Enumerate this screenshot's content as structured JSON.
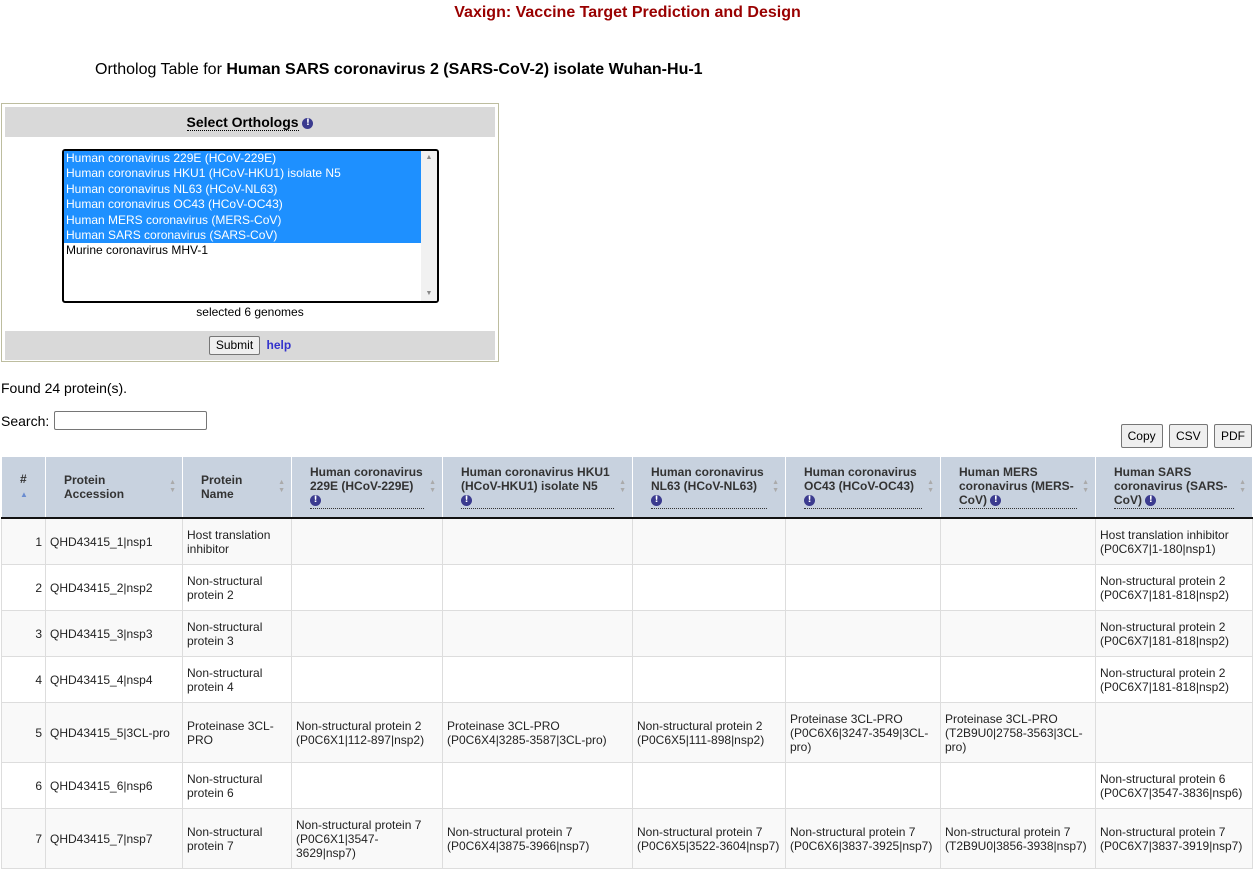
{
  "page": {
    "title": "Vaxign: Vaccine Target Prediction and Design",
    "subtitle_prefix": "Ortholog Table for",
    "subtitle_genome": "Human SARS coronavirus 2 (SARS-CoV-2) isolate Wuhan-Hu-1"
  },
  "selector": {
    "header": "Select Orthologs",
    "options": [
      {
        "label": "Human coronavirus 229E (HCoV-229E)",
        "selected": true
      },
      {
        "label": "Human coronavirus HKU1 (HCoV-HKU1) isolate N5",
        "selected": true
      },
      {
        "label": "Human coronavirus NL63 (HCoV-NL63)",
        "selected": true
      },
      {
        "label": "Human coronavirus OC43 (HCoV-OC43)",
        "selected": true
      },
      {
        "label": "Human MERS coronavirus (MERS-CoV)",
        "selected": true
      },
      {
        "label": "Human SARS coronavirus (SARS-CoV)",
        "selected": true
      },
      {
        "label": "Murine coronavirus MHV-1",
        "selected": false
      }
    ],
    "selected_text": "selected 6 genomes",
    "submit_label": "Submit",
    "help_label": "help"
  },
  "results": {
    "found_text": "Found 24 protein(s).",
    "search_label": "Search:",
    "search_value": ""
  },
  "toolbar": {
    "copy": "Copy",
    "csv": "CSV",
    "pdf": "PDF"
  },
  "table": {
    "headers": [
      "#",
      "Protein Accession",
      "Protein Name",
      "Human coronavirus 229E (HCoV-229E)",
      "Human coronavirus HKU1 (HCoV-HKU1) isolate N5",
      "Human coronavirus NL63 (HCoV-NL63)",
      "Human coronavirus OC43 (HCoV-OC43)",
      "Human MERS coronavirus (MERS-CoV)",
      "Human SARS coronavirus (SARS-CoV)"
    ],
    "rows": [
      {
        "n": "1",
        "acc": "QHD43415_1|nsp1",
        "name": "Host translation inhibitor",
        "c229e": "",
        "hku1": "",
        "nl63": "",
        "oc43": "",
        "mers": "",
        "sars": "Host translation inhibitor (P0C6X7|1-180|nsp1)"
      },
      {
        "n": "2",
        "acc": "QHD43415_2|nsp2",
        "name": "Non-structural protein 2",
        "c229e": "",
        "hku1": "",
        "nl63": "",
        "oc43": "",
        "mers": "",
        "sars": "Non-structural protein 2 (P0C6X7|181-818|nsp2)"
      },
      {
        "n": "3",
        "acc": "QHD43415_3|nsp3",
        "name": "Non-structural protein 3",
        "c229e": "",
        "hku1": "",
        "nl63": "",
        "oc43": "",
        "mers": "",
        "sars": "Non-structural protein 2 (P0C6X7|181-818|nsp2)"
      },
      {
        "n": "4",
        "acc": "QHD43415_4|nsp4",
        "name": "Non-structural protein 4",
        "c229e": "",
        "hku1": "",
        "nl63": "",
        "oc43": "",
        "mers": "",
        "sars": "Non-structural protein 2 (P0C6X7|181-818|nsp2)"
      },
      {
        "n": "5",
        "acc": "QHD43415_5|3CL-pro",
        "name": "Proteinase 3CL-PRO",
        "c229e": "Non-structural protein 2 (P0C6X1|112-897|nsp2)",
        "hku1": "Proteinase 3CL-PRO (P0C6X4|3285-3587|3CL-pro)",
        "nl63": "Non-structural protein 2 (P0C6X5|111-898|nsp2)",
        "oc43": "Proteinase 3CL-PRO (P0C6X6|3247-3549|3CL-pro)",
        "mers": "Proteinase 3CL-PRO (T2B9U0|2758-3563|3CL-pro)",
        "sars": ""
      },
      {
        "n": "6",
        "acc": "QHD43415_6|nsp6",
        "name": "Non-structural protein 6",
        "c229e": "",
        "hku1": "",
        "nl63": "",
        "oc43": "",
        "mers": "",
        "sars": "Non-structural protein 6 (P0C6X7|3547-3836|nsp6)"
      },
      {
        "n": "7",
        "acc": "QHD43415_7|nsp7",
        "name": "Non-structural protein 7",
        "c229e": "Non-structural protein 7 (P0C6X1|3547-3629|nsp7)",
        "hku1": "Non-structural protein 7 (P0C6X4|3875-3966|nsp7)",
        "nl63": "Non-structural protein 7 (P0C6X5|3522-3604|nsp7)",
        "oc43": "Non-structural protein 7 (P0C6X6|3837-3925|nsp7)",
        "mers": "Non-structural protein 7 (T2B9U0|3856-3938|nsp7)",
        "sars": "Non-structural protein 7 (P0C6X7|3837-3919|nsp7)"
      }
    ]
  }
}
